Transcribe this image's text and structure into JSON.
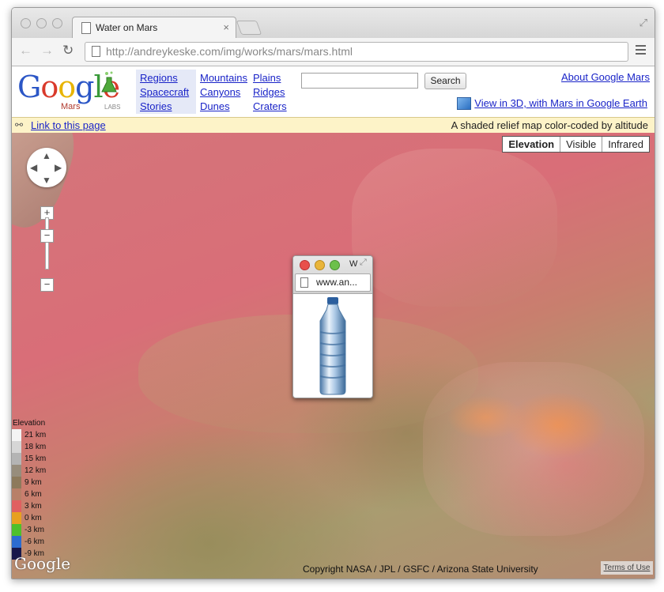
{
  "browser": {
    "tab_title": "Water on Mars",
    "url_host": "http://andreykeske.com",
    "url_path": "/img/works/mars/mars.html"
  },
  "header": {
    "logo_text": "Google",
    "logo_sub": "Mars",
    "logo_labs": "LABS",
    "nav_col1": [
      "Regions",
      "Spacecraft",
      "Stories"
    ],
    "nav_col2": [
      "Mountains",
      "Canyons",
      "Dunes"
    ],
    "nav_col3": [
      "Plains",
      "Ridges",
      "Craters"
    ],
    "search_value": "",
    "search_button": "Search",
    "about_link": "About Google Mars",
    "view3d_link": "View in 3D, with Mars in Google Earth"
  },
  "infobar": {
    "link_label": "Link to this page",
    "description": "A shaded relief map color-coded by altitude"
  },
  "map": {
    "map_types": [
      "Elevation",
      "Visible",
      "Infrared"
    ],
    "active_map_type": "Elevation",
    "zoom_in": "+",
    "zoom_out": "−",
    "legend_title": "Elevation",
    "legend": [
      {
        "label": "21 km",
        "color": "#f4f4f4"
      },
      {
        "label": "18 km",
        "color": "#d6d6d6"
      },
      {
        "label": "15 km",
        "color": "#b4b4b4"
      },
      {
        "label": "12 km",
        "color": "#978d7c"
      },
      {
        "label": "9 km",
        "color": "#8d7a5c"
      },
      {
        "label": "6 km",
        "color": "#b88068"
      },
      {
        "label": "3 km",
        "color": "#e06060"
      },
      {
        "label": "0 km",
        "color": "#e8a020"
      },
      {
        "label": "-3 km",
        "color": "#4ec02c"
      },
      {
        "label": "-6 km",
        "color": "#2c6cd0"
      },
      {
        "label": "-9 km",
        "color": "#18184a"
      }
    ],
    "watermark": "Google",
    "copyright": "Copyright NASA / JPL / GSFC / Arizona State University",
    "terms": "Terms of Use"
  },
  "popup_window": {
    "title_char": "W",
    "url": "www.an..."
  },
  "colors": {
    "link": "#1a24c8",
    "infobar_bg": "#fdf3c8",
    "nav_highlight": "#e5e9f7"
  }
}
